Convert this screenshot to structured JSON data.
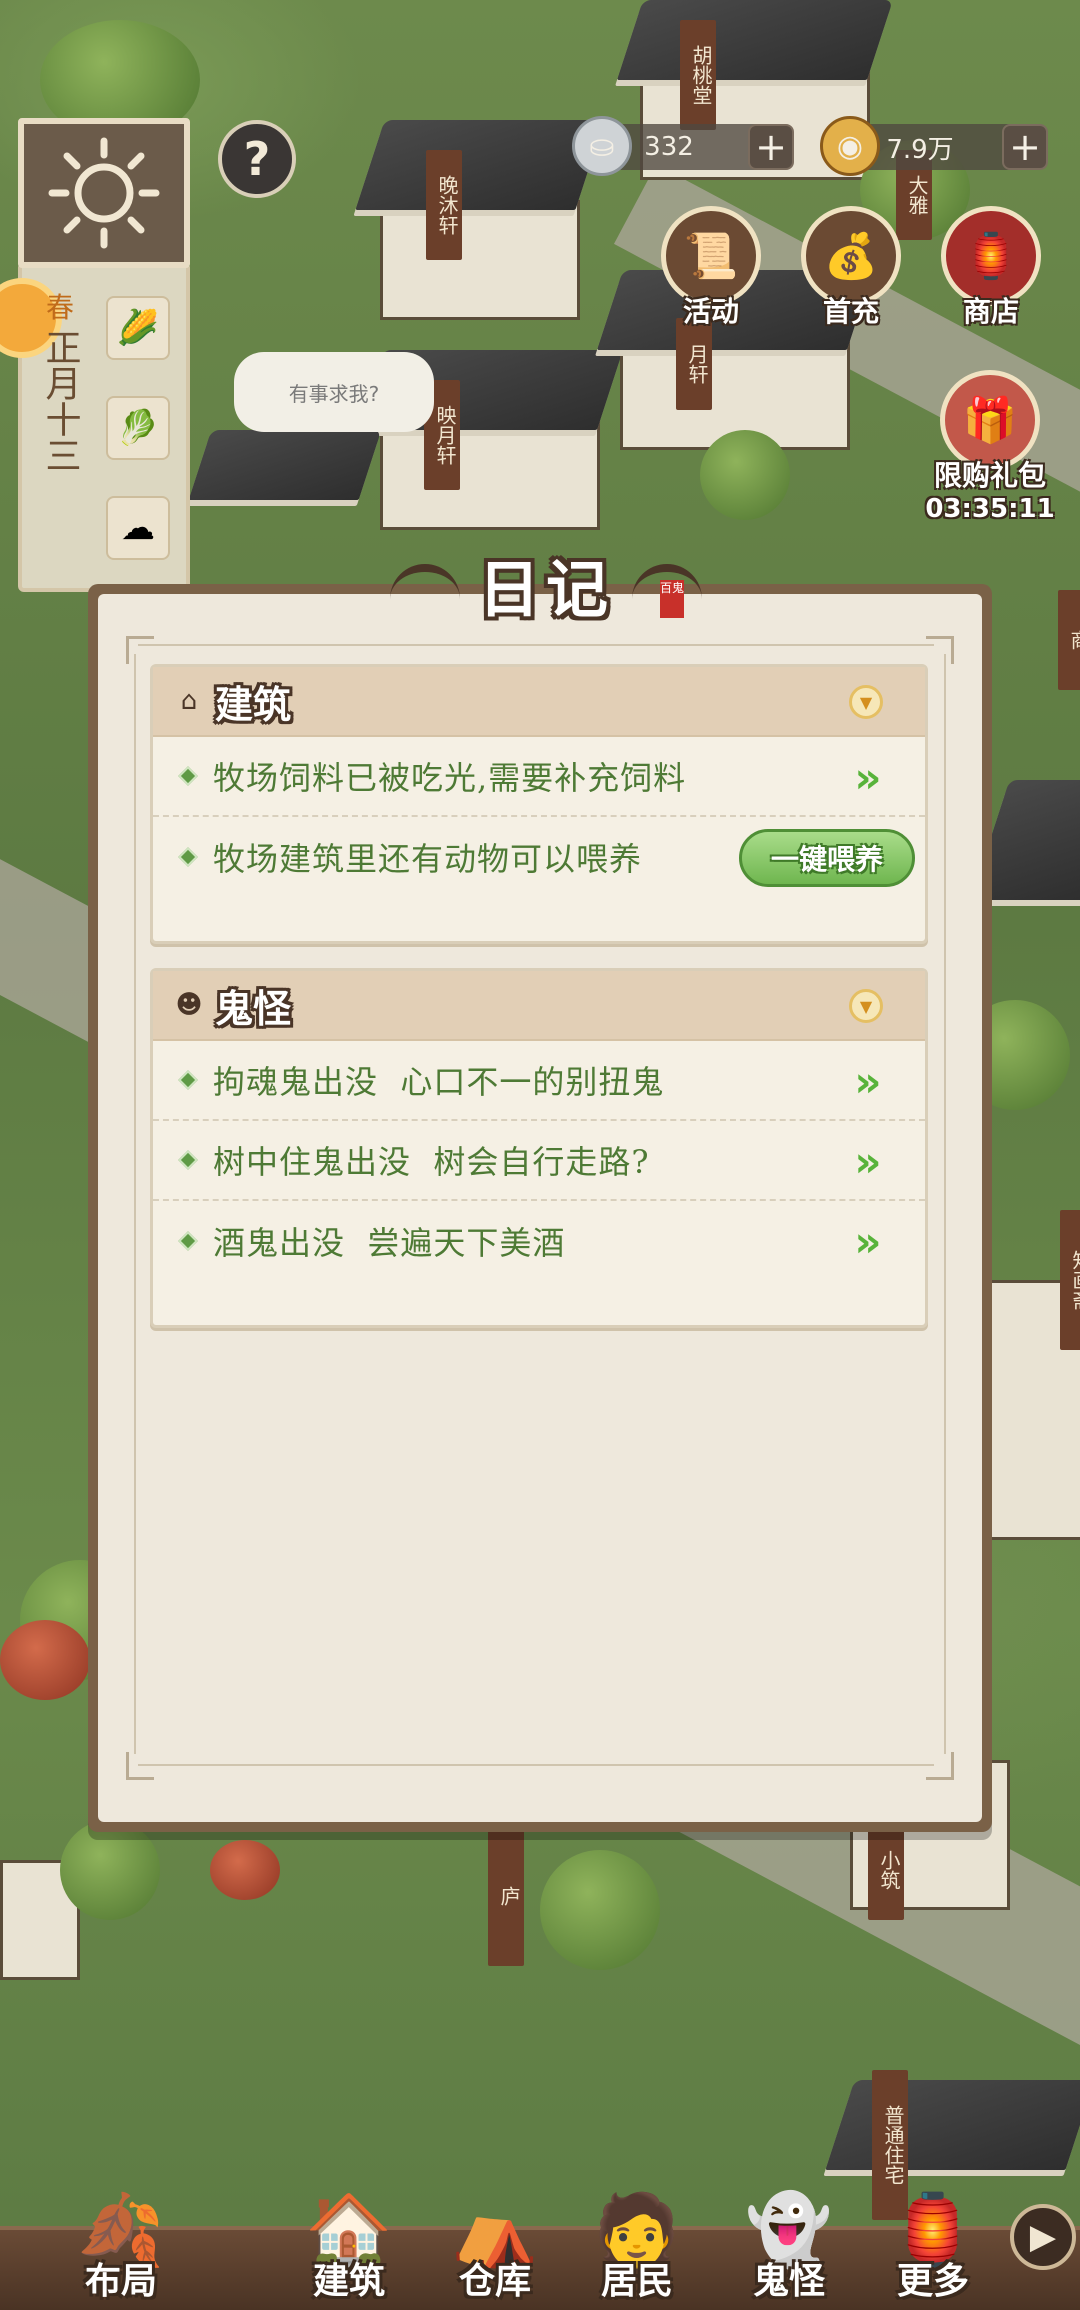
{
  "hud": {
    "season": "春",
    "date": "正月十三",
    "help_icon": "?",
    "bubble_text": "有事求我?",
    "silver": {
      "value": "332",
      "icon": "silver-ingot-icon"
    },
    "copper": {
      "value": "7.9万",
      "icon": "copper-coin-icon"
    },
    "buttons": [
      {
        "label": "活动",
        "icon": "scroll-icon"
      },
      {
        "label": "首充",
        "icon": "money-bag-icon"
      },
      {
        "label": "商店",
        "icon": "shop-icon"
      }
    ],
    "gift": {
      "label": "限购礼包",
      "timer": "03:35:11"
    }
  },
  "scene": {
    "banners": [
      "胡桃堂",
      "晚沐轩",
      "映月轩",
      "月轩",
      "大雅",
      "庐",
      "小筑",
      "知画斋",
      "普通住宅",
      "商"
    ]
  },
  "dialog": {
    "title": "日记",
    "seal": "百鬼",
    "sections": [
      {
        "label": "建筑",
        "icon": "house-icon",
        "rows": [
          {
            "text": "牧场饲料已被吃光,需要补充饲料",
            "action": "go"
          },
          {
            "text": "牧场建筑里还有动物可以喂养",
            "action": "feed",
            "button": "一键喂养"
          }
        ]
      },
      {
        "label": "鬼怪",
        "icon": "ghost-icon",
        "rows": [
          {
            "text": "拘魂鬼出没  心口不一的别扭鬼",
            "action": "go"
          },
          {
            "text": "树中住鬼出没  树会自行走路?",
            "action": "go"
          },
          {
            "text": "酒鬼出没  尝遍天下美酒",
            "action": "go"
          }
        ]
      }
    ]
  },
  "nav": {
    "items": [
      {
        "label": "布局"
      },
      {
        "label": "建筑"
      },
      {
        "label": "仓库"
      },
      {
        "label": "居民"
      },
      {
        "label": "鬼怪"
      },
      {
        "label": "更多"
      }
    ]
  },
  "colors": {
    "panel_brown": "#7a6147",
    "paper": "#eee8dc",
    "accent_green": "#58b33a",
    "text_green": "#4e7a35"
  }
}
